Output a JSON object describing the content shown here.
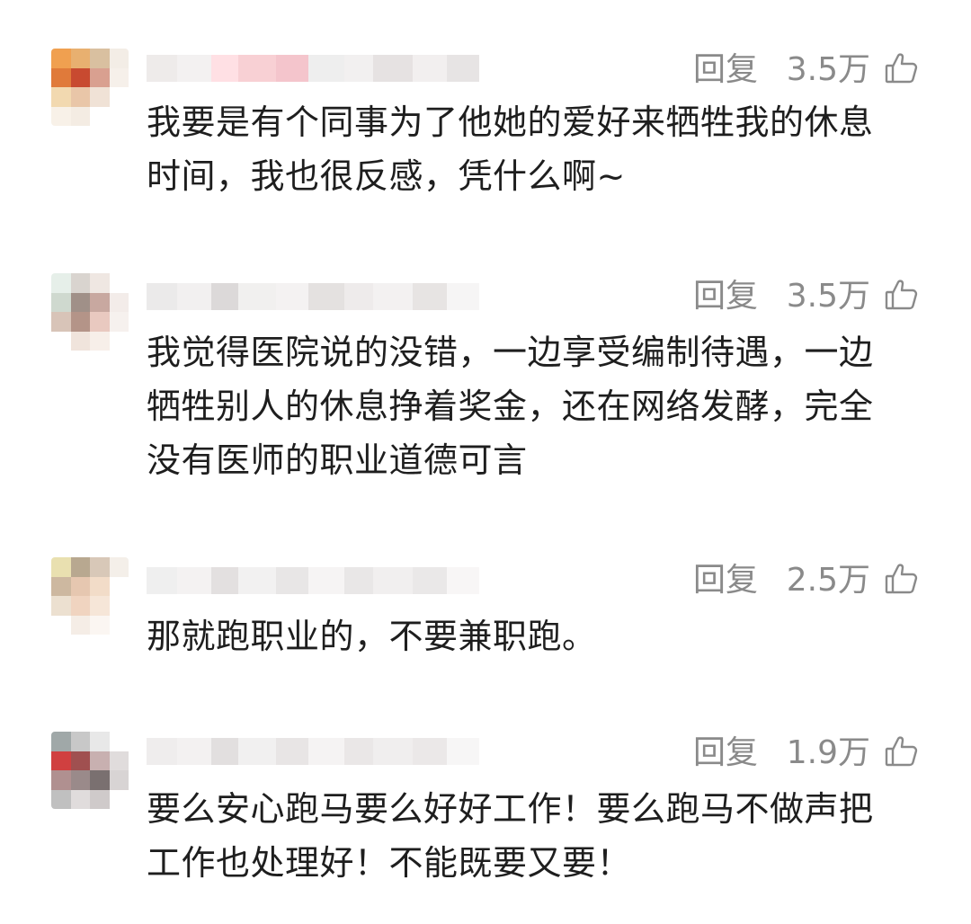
{
  "comments": [
    {
      "text": "我要是有个同事为了他她的爱好来牺牲我的休息\n时间，我也很反感，凭什么啊~",
      "reply_label": "回复",
      "likes": "3.5万",
      "avatar_colors": [
        "#f0a050",
        "#e8b070",
        "#d9c0a0",
        "#f3ede6",
        "#e07a3a",
        "#c84a30",
        "#d9a090",
        "#f6f0ea",
        "#f2d9b0",
        "#e9c6a8",
        "#f0e2d6",
        "#ffffff",
        "#f8f1e8",
        "#f4ece3",
        "#ffffff",
        "#ffffff"
      ]
    },
    {
      "text": "我觉得医院说的没错，一边享受编制待遇，一边\n牺牲别人的休息挣着奖金，还在网络发酵，完全\n没有医师的职业道德可言",
      "reply_label": "回复",
      "likes": "3.5万",
      "avatar_colors": [
        "#e6efe9",
        "#d9d4cf",
        "#efe7e2",
        "#ffffff",
        "#cfd9cf",
        "#a09088",
        "#c8a8a0",
        "#f3ece9",
        "#d8c4b8",
        "#b49488",
        "#e9c9c0",
        "#f6f1ee",
        "#ffffff",
        "#f0e4dc",
        "#f7efe9",
        "#ffffff"
      ]
    },
    {
      "text": "那就跑职业的，不要兼职跑。",
      "reply_label": "回复",
      "likes": "2.5万",
      "avatar_colors": [
        "#e9e0b0",
        "#b8a890",
        "#d8c8b8",
        "#f4efe9",
        "#cdb8a0",
        "#e6c7b0",
        "#f2dcc8",
        "#ffffff",
        "#ece0d0",
        "#f0d4c0",
        "#f6e6d8",
        "#ffffff",
        "#ffffff",
        "#f5ede6",
        "#fbf6f2",
        "#ffffff"
      ]
    },
    {
      "text": "要么安心跑马要么好好工作！要么跑马不做声把\n工作也处理好！不能既要又要！",
      "reply_label": "回复",
      "likes": "1.9万",
      "avatar_colors": [
        "#a0a8a8",
        "#c8c8c8",
        "#e8e8e8",
        "#ffffff",
        "#d04040",
        "#a05050",
        "#c8b0b0",
        "#e0dcdc",
        "#b09090",
        "#9a8a8a",
        "#7a7070",
        "#d8d4d4",
        "#c0c0c0",
        "#e0dcdc",
        "#cfcaca",
        "#ffffff"
      ]
    }
  ],
  "username_blur_colors": [
    [
      "#ebe7e6",
      "#f3f1f1",
      "#ffe0e4",
      "#f7c8cd",
      "#f4c5cc",
      "#eeeeee",
      "#f0eded",
      "#e6e2e2",
      "#f2efef",
      "#e3dfdf"
    ],
    [
      "#e8e6e6",
      "#f2f0f0",
      "#dcd9d9",
      "#efedec",
      "#f4f2f2",
      "#e4e1e0",
      "#ebe8e8",
      "#f3f1f1",
      "#e7e4e3",
      "#f5f3f3"
    ],
    [
      "#ececec",
      "#f4f2f2",
      "#e3e0e0",
      "#f0eeee",
      "#e8e6e6",
      "#f6f4f4",
      "#e5e3e3",
      "#f1efef",
      "#eae8e8",
      "#f7f5f5"
    ],
    [
      "#eceaea",
      "#f3f1f1",
      "#e2dfdf",
      "#efeded",
      "#e8e5e5",
      "#f5f3f3",
      "#e6e3e3",
      "#f0eeee",
      "#ebe8e8",
      "#f6f4f4"
    ]
  ]
}
